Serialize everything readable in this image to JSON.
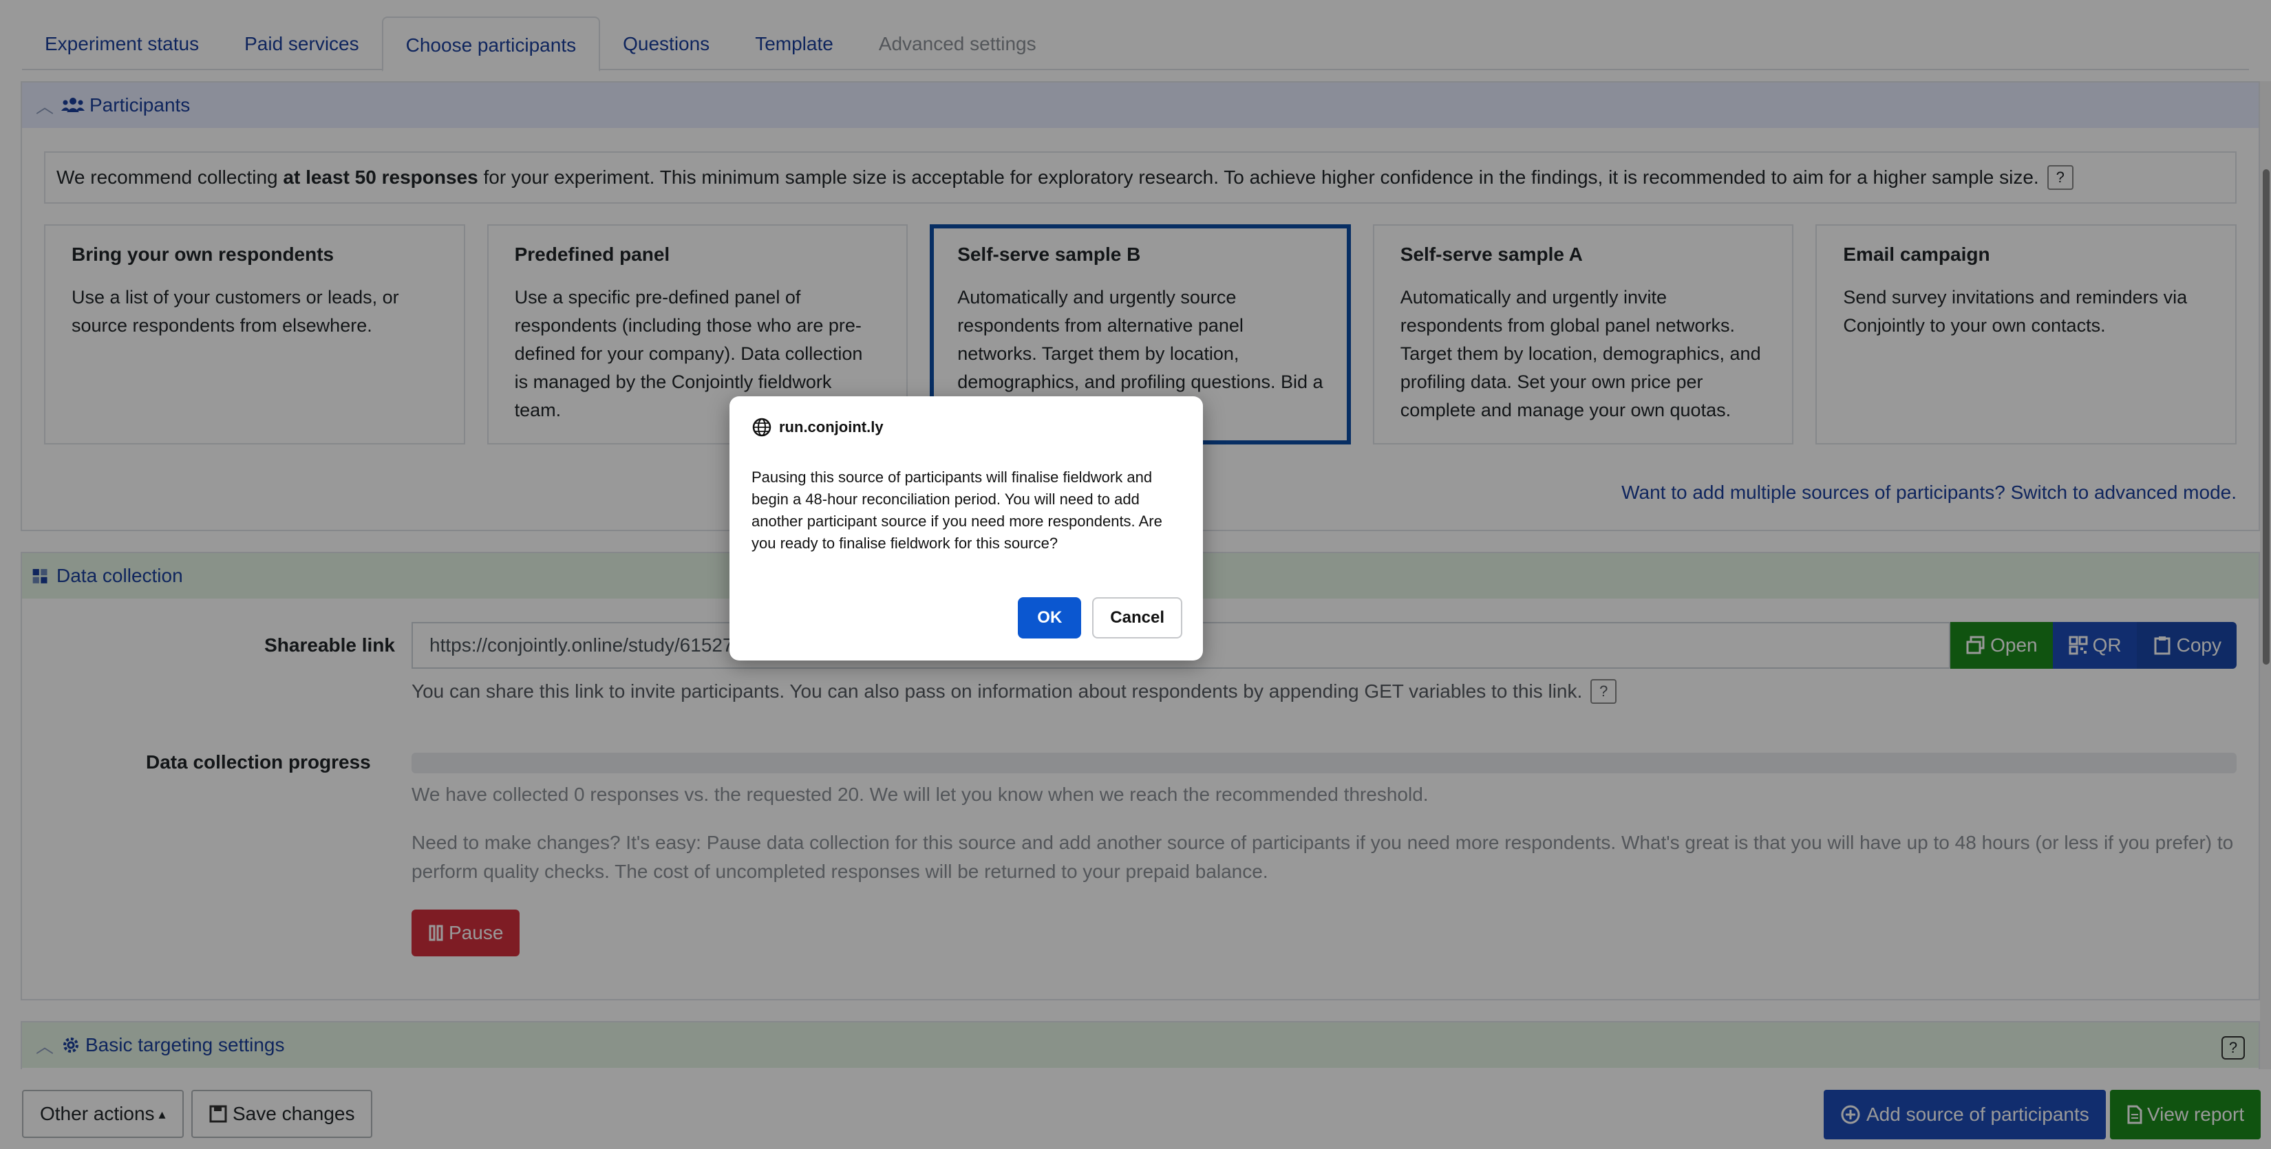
{
  "tabs": [
    {
      "label": "Experiment status"
    },
    {
      "label": "Paid services"
    },
    {
      "label": "Choose participants"
    },
    {
      "label": "Questions"
    },
    {
      "label": "Template"
    },
    {
      "label": "Advanced settings"
    }
  ],
  "participants": {
    "title": "Participants",
    "recommend_pre": "We recommend collecting ",
    "recommend_bold": "at least 50 responses",
    "recommend_post": " for your experiment. This minimum sample size is acceptable for exploratory research. To achieve higher confidence in the findings, it is recommended to aim for a higher sample size.",
    "help_icon": "?",
    "cards": [
      {
        "title": "Bring your own respondents",
        "desc": "Use a list of your customers or leads, or source respondents from elsewhere."
      },
      {
        "title": "Predefined panel",
        "desc": "Use a specific pre-defined panel of respondents (including those who are pre-defined for your company). Data collection is managed by the Conjointly fieldwork team."
      },
      {
        "title": "Self-serve sample B",
        "desc": "Automatically and urgently source respondents from alternative panel networks. Target them by location, demographics, and profiling questions. Bid a price per complete response."
      },
      {
        "title": "Self-serve sample A",
        "desc": "Automatically and urgently invite respondents from global panel networks. Target them by location, demographics, and profiling data. Set your own price per complete and manage your own quotas."
      },
      {
        "title": "Email campaign",
        "desc": "Send survey invitations and reminders via Conjointly to your own contacts."
      }
    ],
    "advanced_link": "Want to add multiple sources of participants? Switch to advanced mode."
  },
  "data_collection": {
    "title": "Data collection",
    "shareable_label": "Shareable link",
    "link_value": "https://conjointly.online/study/61527",
    "open_label": "Open",
    "qr_label": "QR",
    "copy_label": "Copy",
    "share_note": "You can share this link to invite participants. You can also pass on information about respondents by appending GET variables to this link.",
    "progress_label": "Data collection progress",
    "progress": 0,
    "progress_note": "We have collected 0 responses vs. the requested 20. We will let you know when we reach the recommended threshold.",
    "changes_note": "Need to make changes? It's easy: Pause data collection for this source and add another source of participants if you need more respondents. What's great is that you will have up to 48 hours (or less if you prefer) to perform quality checks. The cost of uncompleted responses will be returned to your prepaid balance.",
    "pause_label": "Pause"
  },
  "targeting": {
    "title": "Basic targeting settings",
    "help": "?"
  },
  "footer": {
    "other_actions": "Other actions",
    "save_changes": "Save changes",
    "add_source": "Add source of participants",
    "view_report": "View report"
  },
  "dialog": {
    "origin": "run.conjoint.ly",
    "message": "Pausing this source of participants will finalise fieldwork and begin a 48-hour reconciliation period. You will need to add another participant source if you need more respondents. Are you ready to finalise fieldwork for this source?",
    "ok": "OK",
    "cancel": "Cancel"
  },
  "colors": {
    "accent": "#1a3e9c",
    "green": "#1b8a1b",
    "red": "#d32f3d",
    "dialog_ok": "#0b57d0"
  }
}
